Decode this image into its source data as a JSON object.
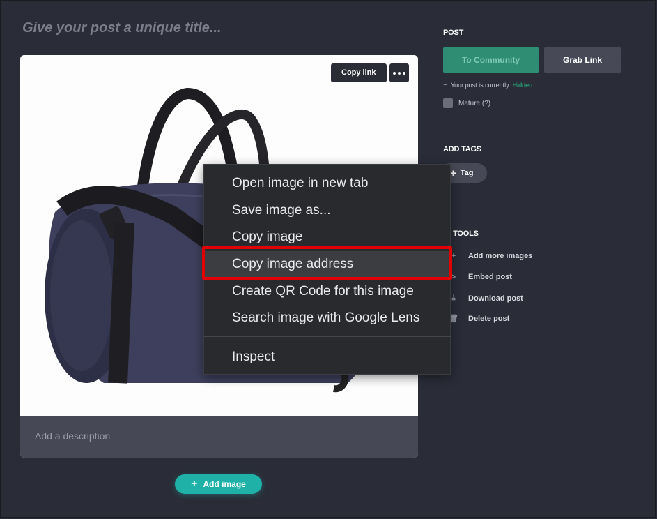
{
  "editor": {
    "title_placeholder": "Give your post a unique title...",
    "description_placeholder": "Add a description",
    "copy_link_label": "Copy link",
    "add_image_label": "Add image"
  },
  "sidebar": {
    "post_heading": "POST",
    "to_community_label": "To Community",
    "grab_link_label": "Grab Link",
    "status_prefix": "Your post is currently",
    "status_value": "Hidden",
    "mature_label": "Mature (?)",
    "add_tags_heading": "ADD TAGS",
    "tag_button_label": "Tag",
    "tools_heading": "IG TOOLS",
    "tools": [
      "Add more images",
      "Embed post",
      "Download post",
      "Delete post"
    ]
  },
  "context_menu": {
    "items": [
      "Open image in new tab",
      "Save image as...",
      "Copy image",
      "Copy image address",
      "Create QR Code for this image",
      "Search image with Google Lens"
    ],
    "inspect_label": "Inspect",
    "highlighted_item": "Copy image address"
  },
  "colors": {
    "background": "#2a2d38",
    "accent_teal": "#1fb1a8",
    "community_green": "#2f8d73",
    "status_hidden": "#25c28a",
    "highlight_box": "#e00000"
  },
  "icons": {
    "add_more_images": "plus-icon",
    "embed_post": "chevron-right-icon",
    "download_post": "download-icon",
    "delete_post": "trash-icon"
  }
}
